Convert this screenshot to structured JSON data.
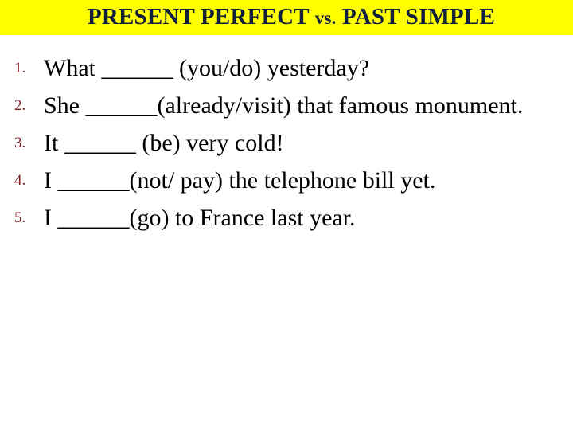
{
  "slide": {
    "background_color": "#ffffff",
    "banner_color": "#ffff00",
    "title_color": "#12203c",
    "number_color": "#7b1f22",
    "body_color": "#000000"
  },
  "header": {
    "title_part1": "PRESENT PERFECT ",
    "title_vs": "vs.",
    "title_part2": " PAST SIMPLE",
    "title_full": "PRESENT PERFECT vs. PAST SIMPLE"
  },
  "exercise": {
    "items": [
      {
        "number": "1.",
        "text": "What ______ (you/do) yesterday?"
      },
      {
        "number": "2.",
        "text": "She ______(already/visit) that famous monument."
      },
      {
        "number": "3.",
        "text": "It ______ (be) very cold!"
      },
      {
        "number": "4.",
        "text": "I ______(not/ pay) the telephone bill yet."
      },
      {
        "number": "5.",
        "text": "I ______(go) to France last year."
      }
    ]
  }
}
